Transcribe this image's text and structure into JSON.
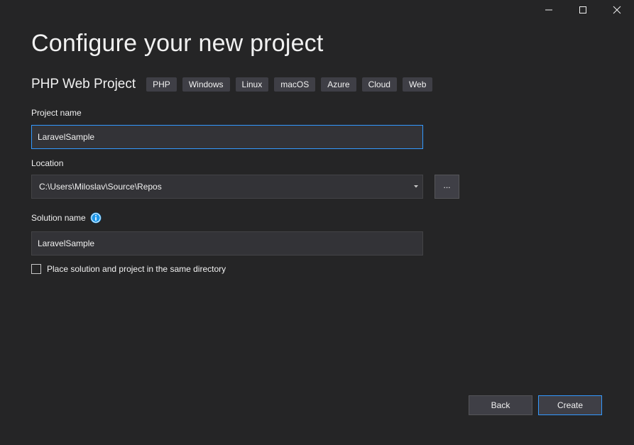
{
  "window": {
    "controls": [
      "minimize-icon",
      "maximize-icon",
      "close-icon"
    ]
  },
  "title": "Configure your new project",
  "template": {
    "name": "PHP Web Project",
    "tags": [
      "PHP",
      "Windows",
      "Linux",
      "macOS",
      "Azure",
      "Cloud",
      "Web"
    ]
  },
  "project_name": {
    "label": "Project name",
    "value": "LaravelSample"
  },
  "location": {
    "label": "Location",
    "value": "C:\\Users\\Miloslav\\Source\\Repos",
    "browse_label": "..."
  },
  "solution_name": {
    "label": "Solution name",
    "value": "LaravelSample",
    "info_icon": "info-icon"
  },
  "same_directory": {
    "label": "Place solution and project in the same directory",
    "checked": false
  },
  "buttons": {
    "back": "Back",
    "create": "Create"
  },
  "colors": {
    "background": "#252526",
    "accent": "#3399ff",
    "input_background": "#333337",
    "tag_background": "#3f3f46"
  }
}
